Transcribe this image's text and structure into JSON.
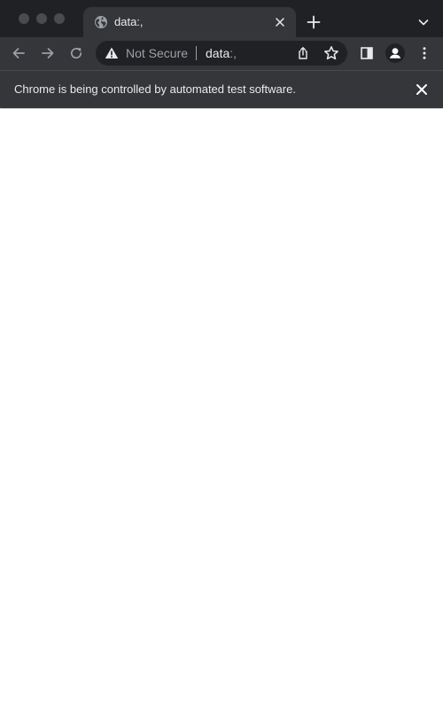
{
  "tab": {
    "title": "data:,"
  },
  "omnibox": {
    "security_label": "Not Secure",
    "url_host": "data",
    "url_rest": ":,"
  },
  "infobar": {
    "message": "Chrome is being controlled by automated test software."
  },
  "icons": {
    "favicon": "globe-icon",
    "tab_close": "close-icon",
    "new_tab": "plus-icon",
    "tab_search": "chevron-down-icon",
    "back": "arrow-left-icon",
    "forward": "arrow-right-icon",
    "reload": "reload-icon",
    "security": "warning-triangle-icon",
    "share": "share-icon",
    "bookmark": "star-icon",
    "side_panel": "side-panel-icon",
    "profile": "person-icon",
    "menu": "kebab-menu-icon",
    "infobar_close": "close-icon"
  },
  "colors": {
    "frame": "#202124",
    "toolbar": "#35363a",
    "text": "#e8eaed",
    "muted": "#9aa0a6",
    "content": "#ffffff"
  }
}
